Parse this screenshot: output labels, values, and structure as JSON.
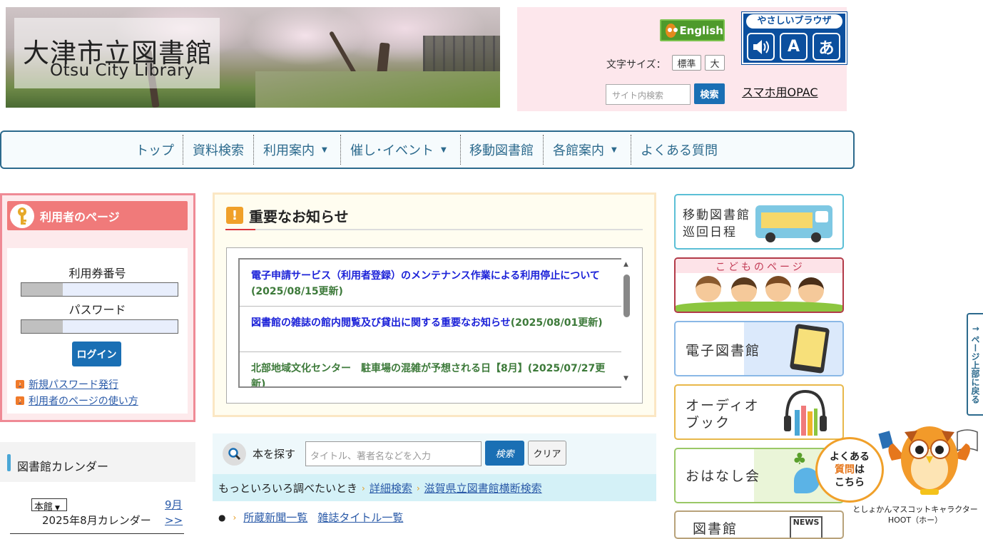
{
  "header": {
    "logo_jp": "大津市立図書館",
    "logo_en": "Otsu City Library",
    "english_label": "English",
    "fontsize_label": "文字サイズ：",
    "fontsize_options": [
      "標準",
      "大"
    ],
    "site_search_placeholder": "サイト内検索",
    "site_search_button": "検索",
    "yasashii_title": "やさしいブラウザ",
    "yasashii_icons": [
      "読み上げ",
      "A",
      "あ"
    ],
    "opac_link": "スマホ用OPAC"
  },
  "nav": {
    "items": [
      "トップ",
      "資料検索",
      "利用案内",
      "催し･イベント",
      "移動図書館",
      "各館案内",
      "よくある質問"
    ]
  },
  "user": {
    "title": "利用者のページ",
    "card_label": "利用券番号",
    "password_label": "パスワード",
    "login_button": "ログイン",
    "links": [
      "新規パスワード発行",
      "利用者のページの使い方"
    ]
  },
  "calendar": {
    "title": "図書館カレンダー",
    "selected_branch": "本館",
    "month_label": "2025年8月カレンダー",
    "next_label": "9月",
    "next_arrow": ">>"
  },
  "notices": {
    "title": "重要なお知らせ",
    "items": [
      {
        "link": "電子申請サービス（利用者登録）のメンテナンス作業による利用停止について",
        "date": "(2025/08/15更新)"
      },
      {
        "link": "図書館の雑誌の館内閲覧及び貸出に関する重要なお知らせ",
        "date": "(2025/08/01更新)"
      },
      {
        "link": "",
        "date": "北部地域文化センター　駐車場の混雑が予想される日【8月】(2025/07/27更新)"
      }
    ]
  },
  "book_search": {
    "label": "本を探す",
    "placeholder": "タイトル、著者名などを入力",
    "search_button": "検索",
    "clear_button": "クリア",
    "more_text": "もっといろいろ調べたいとき",
    "more_links": [
      "詳細検索",
      "滋賀県立図書館横断検索"
    ],
    "news_links": [
      "所蔵新聞一覧",
      "雑誌タイトル一覧"
    ]
  },
  "side_banners": {
    "mobile_library": [
      "移動図書館",
      "巡回日程"
    ],
    "kids": "こどものページ",
    "ebook": "電子図書館",
    "audiobook": [
      "オーディオ",
      "ブック"
    ],
    "storytime": "おはなし会",
    "library_news": "図書館",
    "news_tag": "NEWS"
  },
  "page_top": "ページ上部に戻る",
  "page_top_arrow": "↑",
  "faq_bubble": [
    "よくある",
    "質問",
    "は",
    "こちら"
  ],
  "mascot_caption": [
    "としょかんマスコットキャラクター",
    "HOOT（ホー）"
  ]
}
